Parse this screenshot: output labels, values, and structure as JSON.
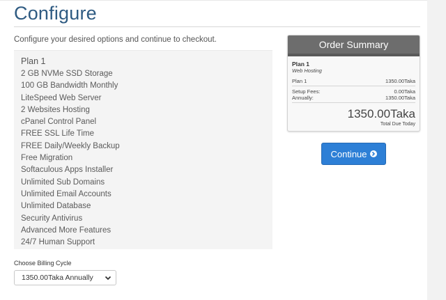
{
  "page": {
    "title": "Configure",
    "intro": "Configure your desired options and continue to checkout."
  },
  "product": {
    "name": "Plan 1",
    "features": [
      "2 GB NVMe SSD Storage",
      "100 GB Bandwidth Monthly",
      "LiteSpeed Web Server",
      "2 Websites Hosting",
      "cPanel Control Panel",
      "FREE SSL Life Time",
      "FREE Daily/Weekly Backup",
      "Free Migration",
      "Softaculous Apps Installer",
      "Unlimited Sub Domains",
      "Unlimited Email Accounts",
      "Unlimited Database",
      "Security Antivirus",
      "Advanced More Features",
      "24/7 Human Support"
    ]
  },
  "billing": {
    "label": "Choose Billing Cycle",
    "selected": "1350.00Taka Annually"
  },
  "summary": {
    "heading": "Order Summary",
    "plan_name": "Plan 1",
    "group": "Web Hosting",
    "line_label": "Plan 1",
    "line_price": "1350.00Taka",
    "setup_label": "Setup Fees:",
    "setup_value": "0.00Taka",
    "annual_label": "Annually:",
    "annual_value": "1350.00Taka",
    "total": "1350.00Taka",
    "total_label": "Total Due Today"
  },
  "actions": {
    "continue_label": "Continue"
  },
  "icons": {
    "continue": "arrow-circle-right-icon",
    "select": "chevron-down-icon"
  },
  "colors": {
    "title": "#2f5b82",
    "button": "#2d7fd6",
    "summary_header": "#6d6d6d"
  }
}
